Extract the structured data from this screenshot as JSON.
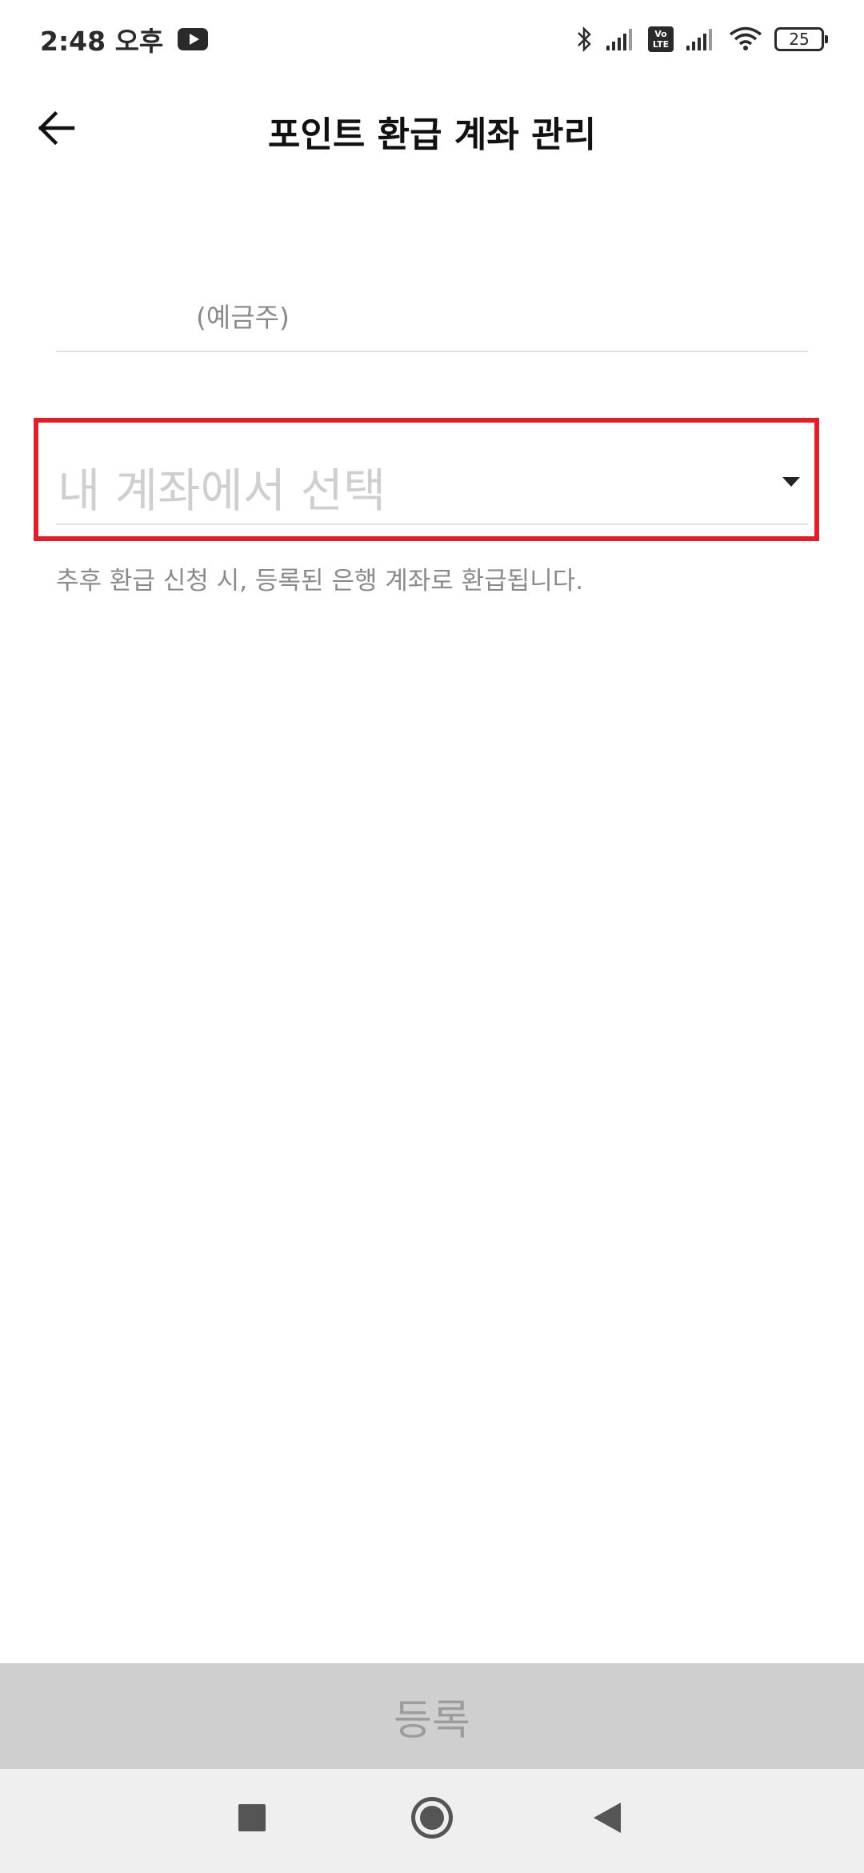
{
  "status_bar": {
    "time": "2:48 오후",
    "battery_level": "25",
    "volte_label_top": "Vo",
    "volte_label_bottom": "LTE",
    "icons": [
      "youtube-icon",
      "bluetooth-icon",
      "signal-icon",
      "volte-icon",
      "signal-icon",
      "wifi-icon",
      "battery-icon"
    ]
  },
  "header": {
    "title": "포인트 환급 계좌 관리",
    "back_icon": "arrow-left-icon"
  },
  "form": {
    "holder_suffix": "(예금주)",
    "account_select_placeholder": "내 계좌에서 선택",
    "help_text": "추후 환급 신청 시, 등록된 은행 계좌로 환급됩니다.",
    "highlight_color": "#e0202a"
  },
  "footer": {
    "register_label": "등록"
  },
  "nav": {
    "icons": [
      "recents-icon",
      "home-icon",
      "back-icon"
    ]
  }
}
